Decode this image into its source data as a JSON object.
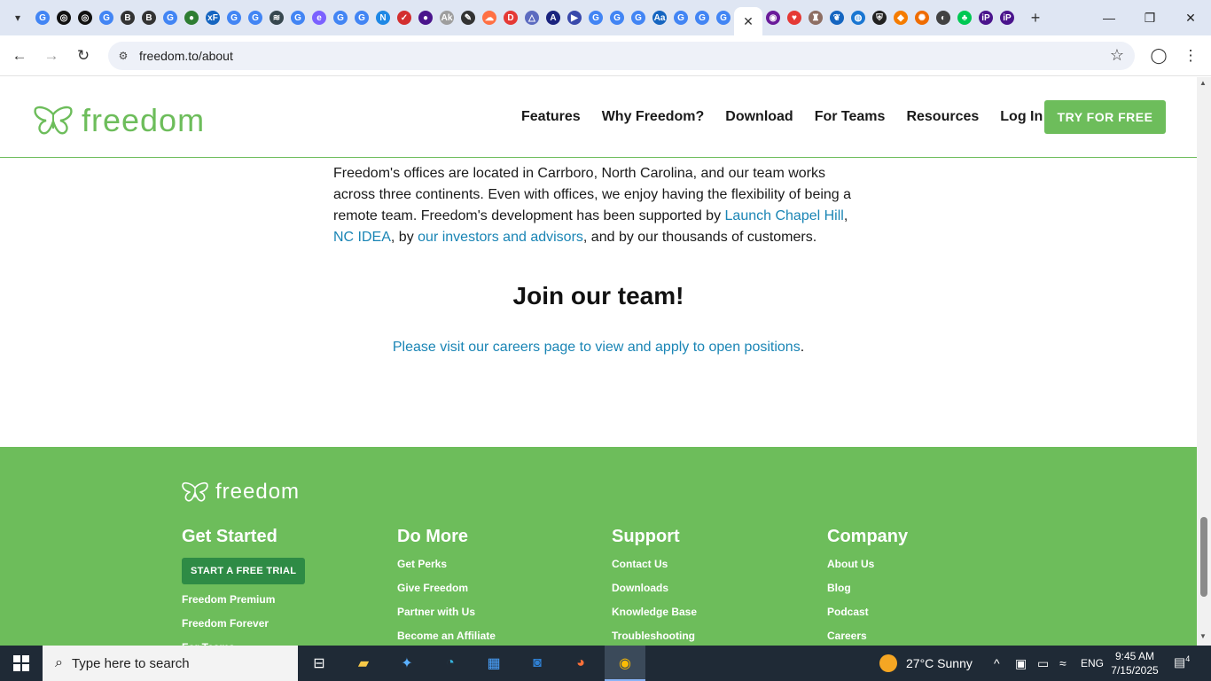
{
  "browser": {
    "favicons": [
      {
        "icon": "google-icon",
        "color": "#4285f4",
        "glyph": "G"
      },
      {
        "icon": "openai-icon",
        "color": "#111111",
        "glyph": "◎"
      },
      {
        "icon": "openai-icon",
        "color": "#111111",
        "glyph": "◎"
      },
      {
        "icon": "google-icon",
        "color": "#4285f4",
        "glyph": "G"
      },
      {
        "icon": "b-icon",
        "color": "#333333",
        "glyph": "B"
      },
      {
        "icon": "b-icon",
        "color": "#333333",
        "glyph": "B"
      },
      {
        "icon": "google-icon",
        "color": "#4285f4",
        "glyph": "G"
      },
      {
        "icon": "globe-green-icon",
        "color": "#2e7d32",
        "glyph": "●"
      },
      {
        "icon": "xf-icon",
        "color": "#1565c0",
        "glyph": "xF"
      },
      {
        "icon": "google-icon",
        "color": "#4285f4",
        "glyph": "G"
      },
      {
        "icon": "google-icon",
        "color": "#4285f4",
        "glyph": "G"
      },
      {
        "icon": "stack-icon",
        "color": "#37474f",
        "glyph": "≋"
      },
      {
        "icon": "google-icon",
        "color": "#4285f4",
        "glyph": "G"
      },
      {
        "icon": "e-icon",
        "color": "#7b61ff",
        "glyph": "e"
      },
      {
        "icon": "google-icon",
        "color": "#4285f4",
        "glyph": "G"
      },
      {
        "icon": "google-icon",
        "color": "#4285f4",
        "glyph": "G"
      },
      {
        "icon": "n-icon",
        "color": "#1e88e5",
        "glyph": "N"
      },
      {
        "icon": "check-icon",
        "color": "#d32f2f",
        "glyph": "✓"
      },
      {
        "icon": "circle-icon",
        "color": "#4a148c",
        "glyph": "●"
      },
      {
        "icon": "adk-icon",
        "color": "#9e9e9e",
        "glyph": "Ak"
      },
      {
        "icon": "bird-icon",
        "color": "#333333",
        "glyph": "✎"
      },
      {
        "icon": "cloud-icon",
        "color": "#ff7043",
        "glyph": "☁"
      },
      {
        "icon": "d-icon",
        "color": "#e53935",
        "glyph": "D"
      },
      {
        "icon": "triangle-icon",
        "color": "#5c6bc0",
        "glyph": "△"
      },
      {
        "icon": "a-icon",
        "color": "#1a237e",
        "glyph": "A"
      },
      {
        "icon": "play-icon",
        "color": "#3949ab",
        "glyph": "▶"
      },
      {
        "icon": "google-icon",
        "color": "#4285f4",
        "glyph": "G"
      },
      {
        "icon": "google-icon",
        "color": "#4285f4",
        "glyph": "G"
      },
      {
        "icon": "google-icon",
        "color": "#4285f4",
        "glyph": "G"
      },
      {
        "icon": "signature-icon",
        "color": "#1565c0",
        "glyph": "Aa"
      },
      {
        "icon": "google-icon",
        "color": "#4285f4",
        "glyph": "G"
      },
      {
        "icon": "google-icon",
        "color": "#4285f4",
        "glyph": "G"
      },
      {
        "icon": "google-icon",
        "color": "#4285f4",
        "glyph": "G"
      }
    ],
    "favicons_after": [
      {
        "icon": "podcast-icon",
        "color": "#6a1b9a",
        "glyph": "◉"
      },
      {
        "icon": "pocket-icon",
        "color": "#e53935",
        "glyph": "♥"
      },
      {
        "icon": "castle-icon",
        "color": "#8d6e63",
        "glyph": "♜"
      },
      {
        "icon": "leaf-icon",
        "color": "#1565c0",
        "glyph": "❦"
      },
      {
        "icon": "globe-icon",
        "color": "#1976d2",
        "glyph": "◍"
      },
      {
        "icon": "shield-icon",
        "color": "#212121",
        "glyph": "⛨"
      },
      {
        "icon": "box-icon",
        "color": "#f57c00",
        "glyph": "◆"
      },
      {
        "icon": "fan-icon",
        "color": "#ef6c00",
        "glyph": "✺"
      },
      {
        "icon": "earth-icon",
        "color": "#424242",
        "glyph": "◐"
      },
      {
        "icon": "tree-icon",
        "color": "#00c853",
        "glyph": "♣"
      },
      {
        "icon": "ip-icon",
        "color": "#4a148c",
        "glyph": "iP"
      },
      {
        "icon": "ip-icon",
        "color": "#4a148c",
        "glyph": "iP"
      }
    ],
    "url": "freedom.to/about"
  },
  "site": {
    "logo_text": "freedom",
    "nav": [
      "Features",
      "Why Freedom?",
      "Download",
      "For Teams",
      "Resources",
      "Log In"
    ],
    "cta": "TRY FOR FREE",
    "para": {
      "t1": "Freedom's offices are located in Carrboro, North Carolina, and our team works across three continents. Even with offices, we enjoy having the flexibility of being a remote team. Freedom's development has been supported by ",
      "link1": "Launch Chapel Hill",
      "t2": ", ",
      "link2": "NC IDEA",
      "t3": ", by ",
      "link3": "our investors and advisors",
      "t4": ", and by our thousands of customers."
    },
    "join_title": "Join our team!",
    "careers_link": "Please visit our careers page to view and apply to open positions",
    "careers_dot": "."
  },
  "footer": {
    "logo_text": "freedom",
    "columns": [
      {
        "title": "Get Started",
        "button": "START A FREE TRIAL",
        "items": [
          "Freedom Premium",
          "Freedom Forever",
          "For Teams"
        ]
      },
      {
        "title": "Do More",
        "items": [
          "Get Perks",
          "Give Freedom",
          "Partner with Us",
          "Become an Affiliate"
        ]
      },
      {
        "title": "Support",
        "items": [
          "Contact Us",
          "Downloads",
          "Knowledge Base",
          "Troubleshooting"
        ]
      },
      {
        "title": "Company",
        "items": [
          "About Us",
          "Blog",
          "Podcast",
          "Careers"
        ]
      }
    ]
  },
  "taskbar": {
    "search_placeholder": "Type here to search",
    "weather": "27°C  Sunny",
    "lang": "ENG",
    "time": "9:45 AM",
    "date": "7/15/2025",
    "notifications": "4"
  },
  "colors": {
    "brand_green": "#6dbd5b",
    "link_blue": "#1a85b5",
    "trial_green": "#2e8b45"
  }
}
